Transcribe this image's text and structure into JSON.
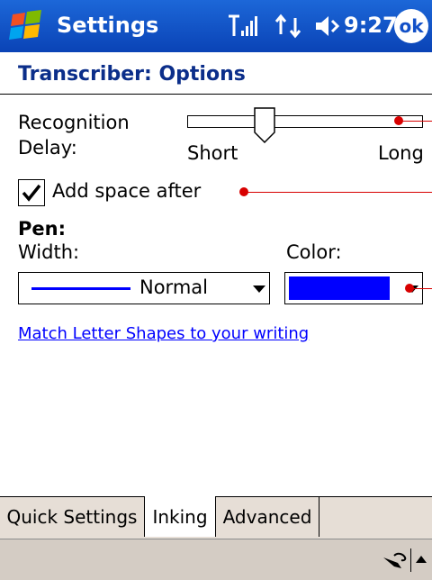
{
  "titlebar": {
    "title": "Settings",
    "time": "9:27",
    "ok_label": "ok"
  },
  "page": {
    "title": "Transcriber: Options"
  },
  "recognition_delay": {
    "label_line1": "Recognition",
    "label_line2": "Delay:",
    "min_label": "Short",
    "max_label": "Long",
    "value_fraction": 0.33
  },
  "add_space": {
    "label": "Add space after",
    "checked": true
  },
  "pen": {
    "heading": "Pen:",
    "width_label": "Width:",
    "width_value": "Normal",
    "color_label": "Color:",
    "color_value": "#0000ff"
  },
  "link": {
    "text": "Match Letter Shapes to your writing"
  },
  "tabs": [
    {
      "label": "Quick Settings",
      "active": false
    },
    {
      "label": "Inking",
      "active": true
    },
    {
      "label": "Advanced",
      "active": false
    }
  ],
  "colors": {
    "titlebar": "#0a43b6",
    "heading": "#0b2e8a",
    "link": "#0000ff",
    "callout": "#d80000",
    "tabbar": "#e6ded6"
  },
  "icons": [
    "windows-start-icon",
    "signal-icon",
    "connectivity-icon",
    "speaker-icon",
    "input-pen-icon",
    "up-arrow-icon"
  ]
}
